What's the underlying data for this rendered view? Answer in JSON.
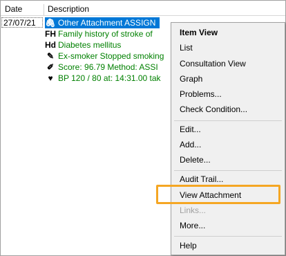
{
  "columns": {
    "date": "Date",
    "description": "Description"
  },
  "rows": [
    {
      "date": "27/07/21",
      "icon": "paperclip-icon",
      "glyph": "🖇",
      "text": "Other Attachment  ASSIGN",
      "selected": true
    },
    {
      "date": "",
      "icon": "family-history-icon",
      "glyph": "FH",
      "text": "Family history of stroke of",
      "selected": false
    },
    {
      "date": "",
      "icon": "diagnosis-icon",
      "glyph": "Hd",
      "text": "Diabetes mellitus",
      "selected": false
    },
    {
      "date": "",
      "icon": "pen-icon",
      "glyph": "✎",
      "text": "Ex-smoker  Stopped smoking",
      "selected": false
    },
    {
      "date": "",
      "icon": "score-icon",
      "glyph": "✐",
      "text": "Score:  96.79  Method:  ASSI",
      "selected": false
    },
    {
      "date": "",
      "icon": "blood-pressure-icon",
      "glyph": "♥",
      "text": "BP 120 / 80  at: 14:31.00 tak",
      "selected": false
    }
  ],
  "menu": {
    "item_view": "Item View",
    "list": "List",
    "consultation_view": "Consultation View",
    "graph": "Graph",
    "problems": "Problems...",
    "check_condition": "Check Condition...",
    "edit": "Edit...",
    "add": "Add...",
    "delete": "Delete...",
    "audit_trail": "Audit Trail...",
    "view_attachment": "View Attachment",
    "links": "Links...",
    "more": "More...",
    "help": "Help"
  },
  "colors": {
    "selection": "#0078d7",
    "text_green": "#008000",
    "highlight": "#f5a623"
  }
}
